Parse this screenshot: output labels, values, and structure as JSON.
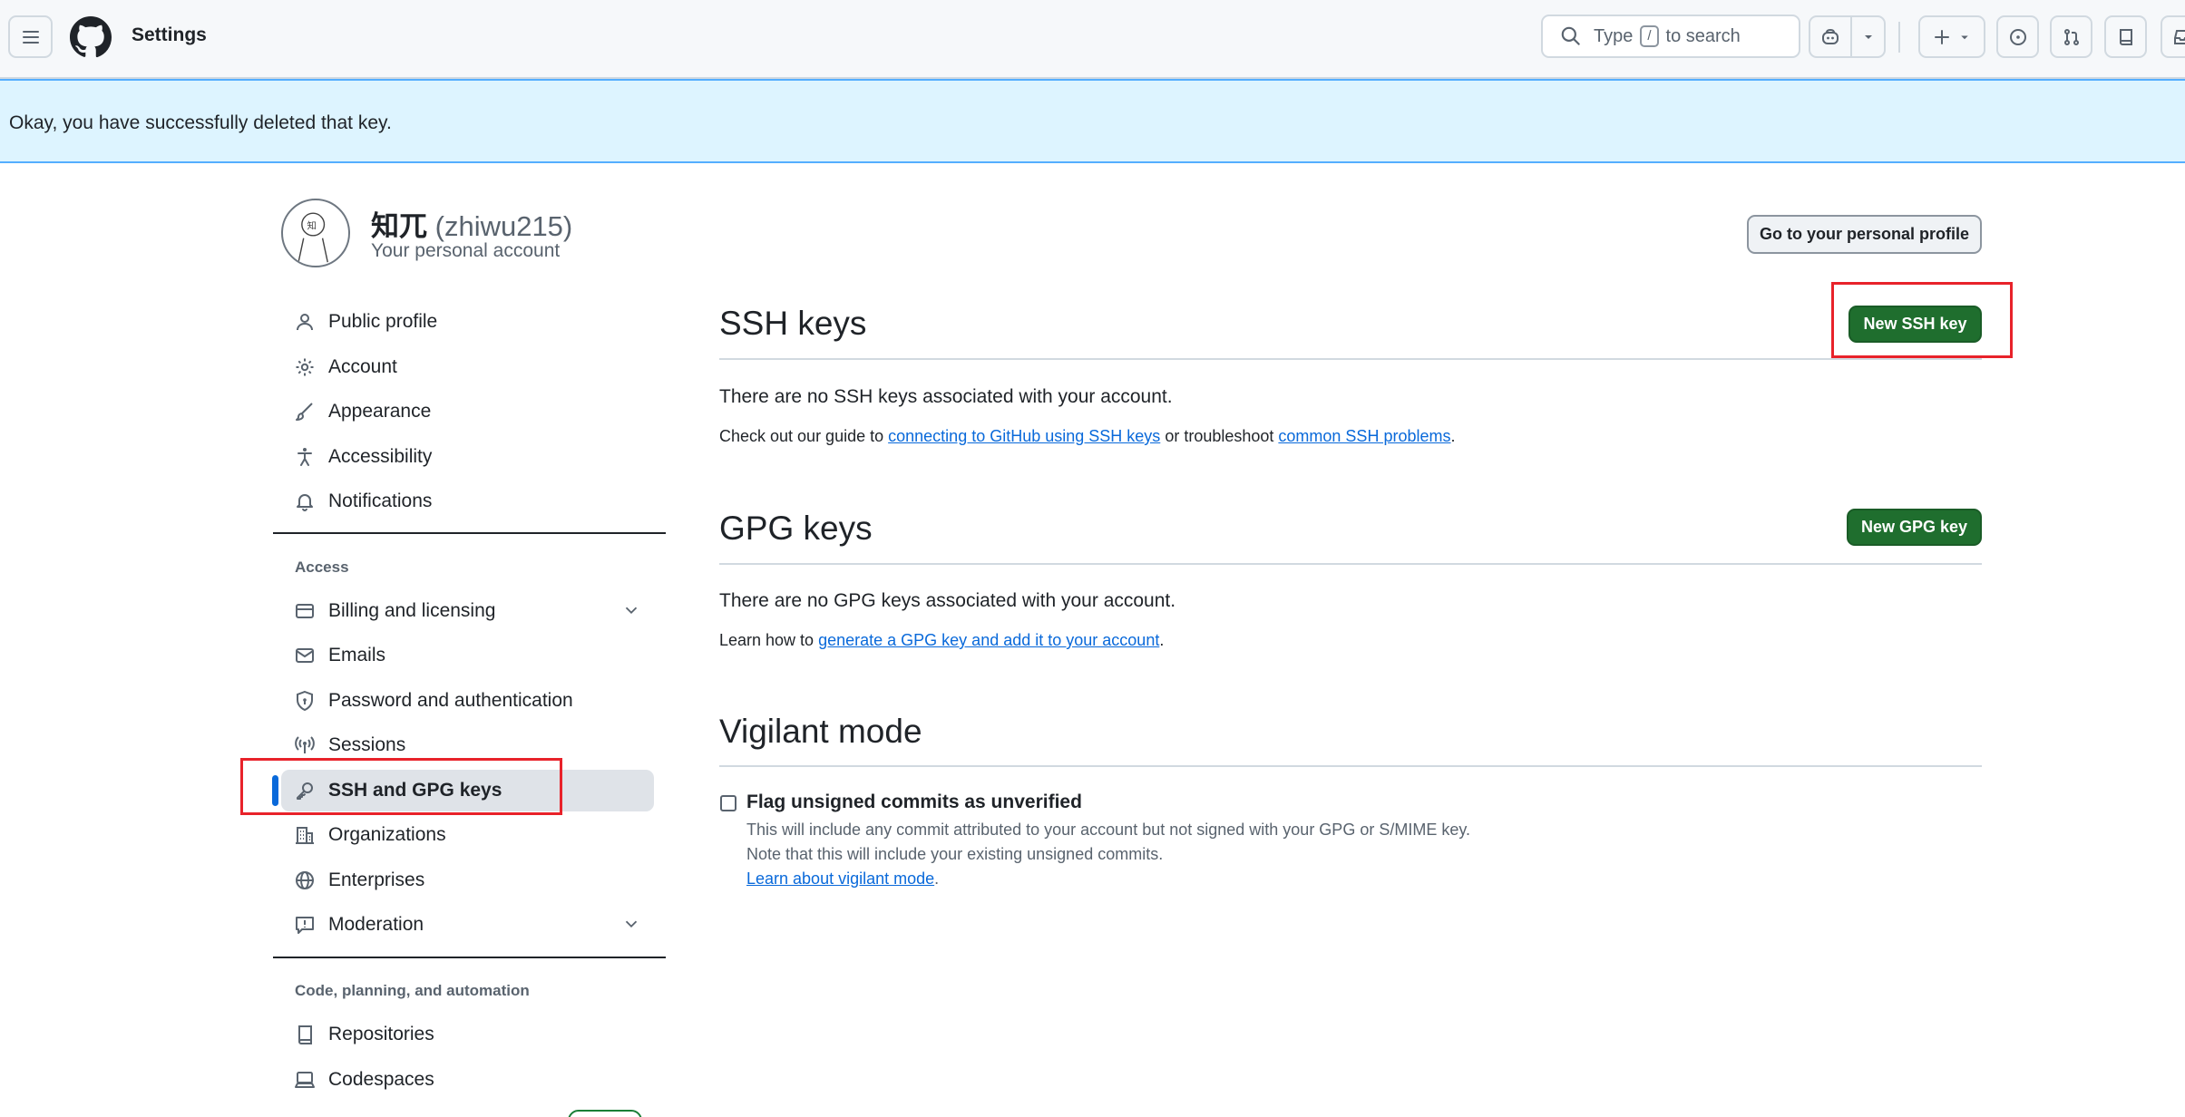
{
  "header": {
    "title": "Settings",
    "search_prefix": "Type",
    "search_key": "/",
    "search_suffix": "to search"
  },
  "flash": {
    "message": "Okay, you have successfully deleted that key."
  },
  "account": {
    "name": "知兀",
    "login": "(zhiwu215)",
    "subtitle": "Your personal account",
    "profile_button": "Go to your personal profile"
  },
  "sidebar": {
    "items_top": [
      {
        "label": "Public profile",
        "icon": "person-icon"
      },
      {
        "label": "Account",
        "icon": "gear-icon"
      },
      {
        "label": "Appearance",
        "icon": "paintbrush-icon"
      },
      {
        "label": "Accessibility",
        "icon": "accessibility-icon"
      },
      {
        "label": "Notifications",
        "icon": "bell-icon"
      }
    ],
    "group_access": "Access",
    "items_access": [
      {
        "label": "Billing and licensing",
        "icon": "credit-card-icon"
      },
      {
        "label": "Emails",
        "icon": "mail-icon"
      },
      {
        "label": "Password and authentication",
        "icon": "shield-lock-icon"
      },
      {
        "label": "Sessions",
        "icon": "broadcast-icon"
      },
      {
        "label": "SSH and GPG keys",
        "icon": "key-icon"
      },
      {
        "label": "Organizations",
        "icon": "organization-icon"
      },
      {
        "label": "Enterprises",
        "icon": "globe-icon"
      },
      {
        "label": "Moderation",
        "icon": "report-icon"
      }
    ],
    "group_code": "Code, planning, and automation",
    "items_code": [
      {
        "label": "Repositories",
        "icon": "repo-icon"
      },
      {
        "label": "Codespaces",
        "icon": "codespaces-icon"
      }
    ]
  },
  "ssh": {
    "title": "SSH keys",
    "button": "New SSH key",
    "empty": "There are no SSH keys associated with your account.",
    "guide_prefix": "Check out our guide to",
    "guide_link": "connecting to GitHub using SSH keys",
    "guide_middle": "or troubleshoot",
    "guide_link2": "common SSH problems",
    "guide_end": "."
  },
  "gpg": {
    "title": "GPG keys",
    "button": "New GPG key",
    "empty": "There are no GPG keys associated with your account.",
    "learn_prefix": "Learn how to",
    "learn_link": "generate a GPG key and add it to your account",
    "learn_end": "."
  },
  "vigilant": {
    "title": "Vigilant mode",
    "checkbox_label": "Flag unsigned commits as unverified",
    "note1": "This will include any commit attributed to your account but not signed with your GPG or S/MIME key.",
    "note2": "Note that this will include your existing unsigned commits.",
    "link": "Learn about vigilant mode",
    "link_end": ".",
    "checked": false
  },
  "colors": {
    "accent": "#0969da",
    "primary_button": "#1f6e2e",
    "flash_bg": "#ddf4ff",
    "highlight": "#e8222a"
  }
}
